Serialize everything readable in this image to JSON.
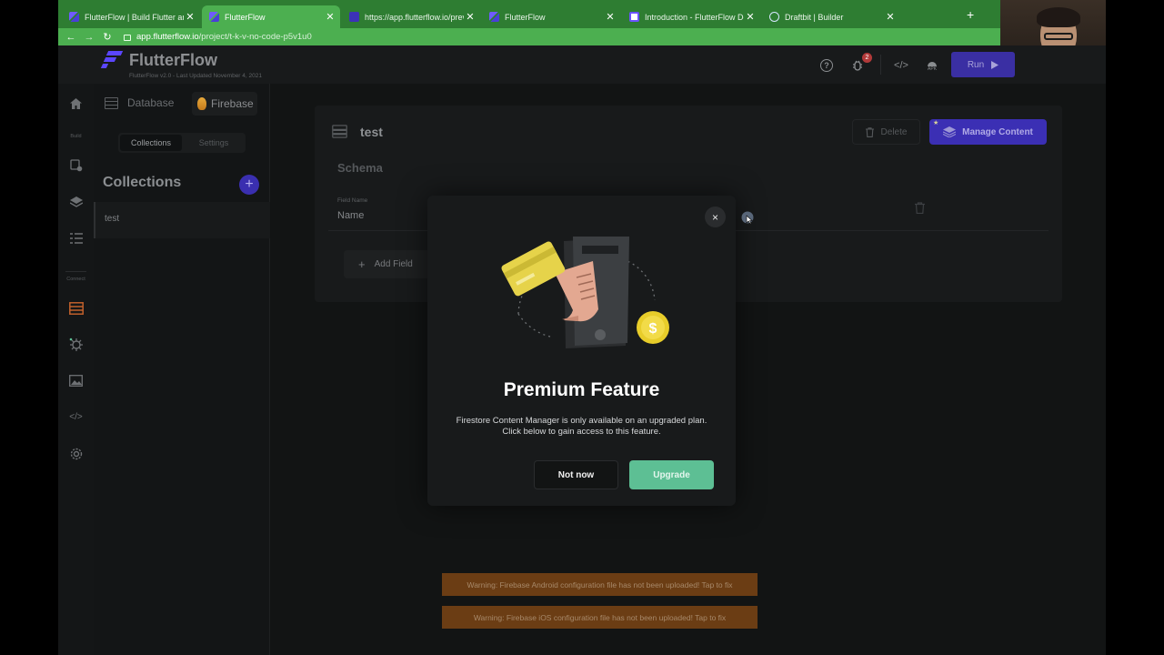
{
  "browser": {
    "tabs": [
      {
        "title": "FlutterFlow | Build Flutter and Fl"
      },
      {
        "title": "FlutterFlow"
      },
      {
        "title": "https://app.flutterflow.io/previe"
      },
      {
        "title": "FlutterFlow"
      },
      {
        "title": "Introduction - FlutterFlow Docs"
      },
      {
        "title": "Draftbit | Builder"
      }
    ],
    "new_tab": "+",
    "url_host": "app.flutterflow.io",
    "url_path": "/project/t-k-v-no-code-p5v1u0"
  },
  "app": {
    "brand": "FlutterFlow",
    "version_text": "FlutterFlow v2.0 - Last Updated November 4, 2021",
    "bug_badge_count": "2",
    "apk_label": "APK",
    "run_label": "Run",
    "rail": {
      "build_label": "Build",
      "connect_label": "Connect"
    },
    "panel": {
      "database_label": "Database",
      "firebase_label": "Firebase",
      "tabs": {
        "collections": "Collections",
        "settings": "Settings"
      },
      "collections_title": "Collections",
      "add_symbol": "+",
      "collections": [
        {
          "name": "test"
        }
      ]
    },
    "main": {
      "collection_title": "test",
      "delete_label": "Delete",
      "manage_content_label": "Manage Content",
      "schema_title": "Schema",
      "field_name_label": "Field Name",
      "field_name_value": "Name",
      "add_field_label": "Add Field"
    },
    "warnings": [
      "Warning: Firebase Android configuration file has not been uploaded! Tap to fix",
      "Warning: Firebase iOS configuration file has not been uploaded! Tap to fix"
    ]
  },
  "modal": {
    "close_symbol": "×",
    "title": "Premium Feature",
    "body": "Firestore Content Manager is only available on an upgraded plan. Click below to gain access to this feature.",
    "not_now_label": "Not now",
    "upgrade_label": "Upgrade",
    "coin_symbol": "$"
  },
  "colors": {
    "accent": "#3b2fb4",
    "upgrade": "#5dbf94",
    "warning": "#6b3d14",
    "browser": "#4caf50"
  }
}
